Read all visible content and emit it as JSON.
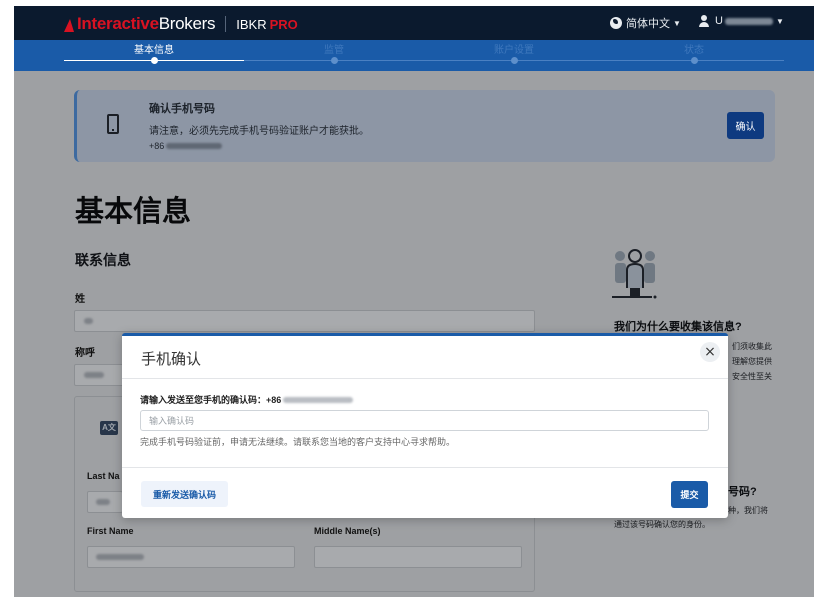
{
  "header": {
    "logo_interactive": "Interactive",
    "logo_brokers": "Brokers",
    "logo_ibkr": "IBKR",
    "logo_pro": "PRO",
    "language": "简体中文",
    "user_prefix": "U",
    "accent": "#d81222"
  },
  "steps": {
    "items": [
      {
        "label": "基本信息",
        "active": true
      },
      {
        "label": "监管",
        "active": false
      },
      {
        "label": "账户设置",
        "active": false
      },
      {
        "label": "状态",
        "active": false
      }
    ]
  },
  "phone_card": {
    "title": "确认手机号码",
    "text": "请注意，必须先完成手机号码验证账户才能获批。",
    "phone_prefix": "+86",
    "confirm_label": "确认"
  },
  "page": {
    "title": "基本信息",
    "section": "联系信息",
    "surname_label": "姓",
    "title_label": "称呼",
    "last_name_label": "Last Na",
    "first_name_label": "First Name",
    "middle_name_label": "Middle Name(s)"
  },
  "sidebar": {
    "why_title": "我们为什么要收集该信息?",
    "why_lines": [
      "们须收集此",
      "理解您提供",
      "安全性至关"
    ],
    "why2_title": "号码?",
    "why2_line1": "种，我们将",
    "why2_line2": "通过该号码确认您的身份。"
  },
  "modal": {
    "title": "手机确认",
    "close_icon": "×",
    "prompt": "请输入发送至您手机的确认码：",
    "phone_prefix": "+86",
    "input_placeholder": "输入确认码",
    "help": "完成手机号码验证前，申请无法继续。请联系您当地的客户支持中心寻求帮助。",
    "resend_label": "重新发送确认码",
    "submit_label": "提交",
    "brand_blue": "#1a5ba8"
  }
}
